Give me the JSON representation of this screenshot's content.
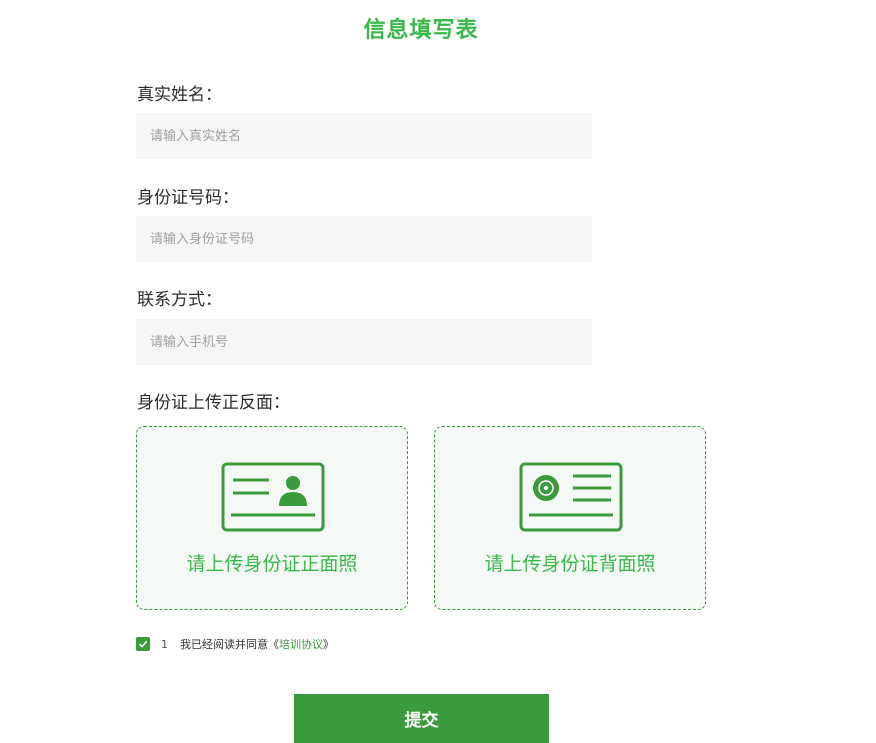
{
  "form": {
    "title": "信息填写表",
    "fields": [
      {
        "label": "真实姓名：",
        "placeholder": "请输入真实姓名",
        "value": ""
      },
      {
        "label": "身份证号码：",
        "placeholder": "请输入身份证号码",
        "value": ""
      },
      {
        "label": "联系方式：",
        "placeholder": "请输入手机号",
        "value": ""
      }
    ],
    "upload": {
      "label": "身份证上传正反面：",
      "front_text": "请上传身份证正面照",
      "back_text": "请上传身份证背面照"
    },
    "agreement": {
      "checked": true,
      "number": "1",
      "text": "我已经阅读并同意",
      "link_open": "《",
      "link_text": "培训协议",
      "link_close": "》"
    },
    "submit_label": "提交"
  },
  "colors": {
    "accent": "#3a9b3c",
    "title_green": "#3ab94a",
    "input_bg": "#f6f6f6",
    "upload_bg": "#f5f9f5"
  },
  "icons": {
    "front": "id-card-front-icon",
    "back": "id-card-back-icon",
    "checkbox": "checkmark-icon"
  }
}
